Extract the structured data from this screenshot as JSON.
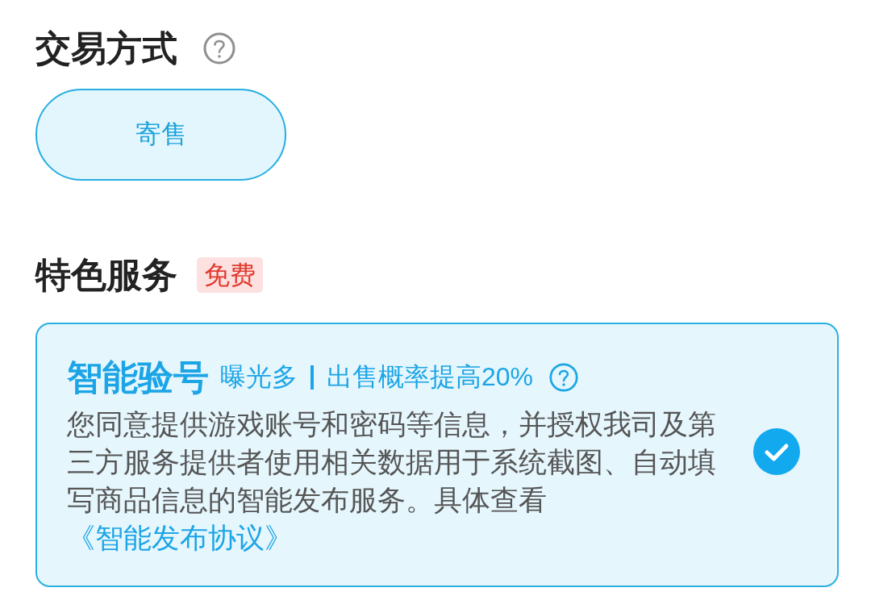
{
  "trade_method": {
    "title": "交易方式",
    "options": [
      {
        "label": "寄售",
        "selected": true
      }
    ]
  },
  "featured_services": {
    "title": "特色服务",
    "badge": "免费",
    "services": [
      {
        "name": "智能验号",
        "taglines": [
          "曝光多",
          "出售概率提高20%"
        ],
        "description": "您同意提供游戏账号和密码等信息，并授权我司及第三方服务提供者使用相关数据用于系统截图、自动填写商品信息的智能发布服务。具体查看",
        "link": "《智能发布协议》",
        "checked": true
      }
    ]
  }
}
